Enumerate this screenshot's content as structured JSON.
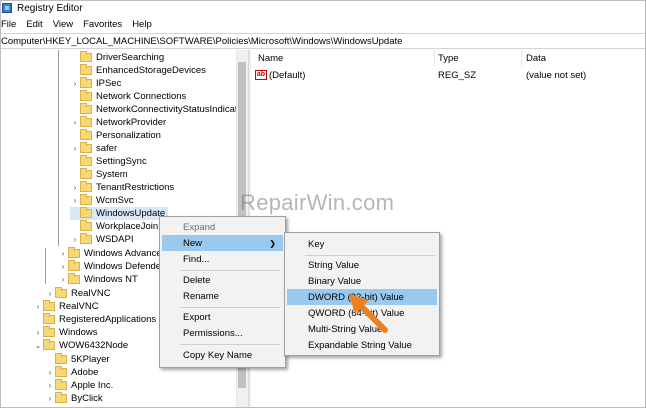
{
  "window": {
    "title": "Registry Editor"
  },
  "menubar": [
    "File",
    "Edit",
    "View",
    "Favorites",
    "Help"
  ],
  "address": "Computer\\HKEY_LOCAL_MACHINE\\SOFTWARE\\Policies\\Microsoft\\Windows\\WindowsUpdate",
  "tree": {
    "windows_children": [
      "DriverSearching",
      "EnhancedStorageDevices",
      "IPSec",
      "Network Connections",
      "NetworkConnectivityStatusIndicator",
      "NetworkProvider",
      "Personalization",
      "safer",
      "SettingSync",
      "System",
      "TenantRestrictions",
      "WcmSvc",
      "WindowsUpdate",
      "WorkplaceJoin",
      "WSDAPI"
    ],
    "microsoft_children": [
      "Windows Advanced",
      "Windows Defender",
      "Windows NT"
    ],
    "software_children": [
      "RealVNC"
    ],
    "root_children": [
      "RealVNC",
      "RegisteredApplications",
      "Windows",
      "WOW6432Node"
    ],
    "wow_children": [
      "5KPlayer",
      "Adobe",
      "Apple Inc.",
      "ByClick"
    ]
  },
  "list": {
    "headers": {
      "name": "Name",
      "type": "Type",
      "data": "Data"
    },
    "rows": [
      {
        "name": "(Default)",
        "type": "REG_SZ",
        "data": "(value not set)",
        "icon": "string-value-icon"
      }
    ]
  },
  "context_menu": {
    "items": [
      "Expand",
      "New",
      "Find...",
      "Delete",
      "Rename",
      "Export",
      "Permissions...",
      "Copy Key Name"
    ]
  },
  "submenu": {
    "items": [
      "Key",
      "String Value",
      "Binary Value",
      "DWORD (32-bit) Value",
      "QWORD (64-bit) Value",
      "Multi-String Value",
      "Expandable String Value"
    ]
  },
  "watermark": "RepairWin.com",
  "colors": {
    "highlight": "#99c9ef",
    "selected_row": "#d9e8f7",
    "arrow": "#f07f1e",
    "folder": "#f8d775"
  }
}
